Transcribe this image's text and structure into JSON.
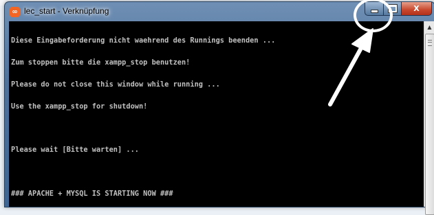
{
  "window": {
    "title": "lec_start - Verknüpfung",
    "app_icon": "xampp-icon",
    "controls": {
      "minimize": "minimize-icon",
      "maximize": "maximize-icon",
      "close": "close-icon",
      "close_glyph": "X"
    }
  },
  "console": {
    "lines": [
      "Diese Eingabeforderung nicht waehrend des Runnings beenden ...",
      "Zum stoppen bitte die xampp_stop benutzen!",
      "Please do not close this window while running ...",
      "Use the xampp_stop for shutdown!",
      "",
      "Please wait [Bitte warten] ...",
      "",
      "### APACHE + MYSQL IS STARTING NOW ###"
    ]
  },
  "annotation": {
    "circle_color": "#ffffff",
    "arrow_color": "#ffffff"
  },
  "colors": {
    "console_bg": "#000000",
    "console_fg": "#c0c0c0",
    "close_red": "#c8472d"
  }
}
